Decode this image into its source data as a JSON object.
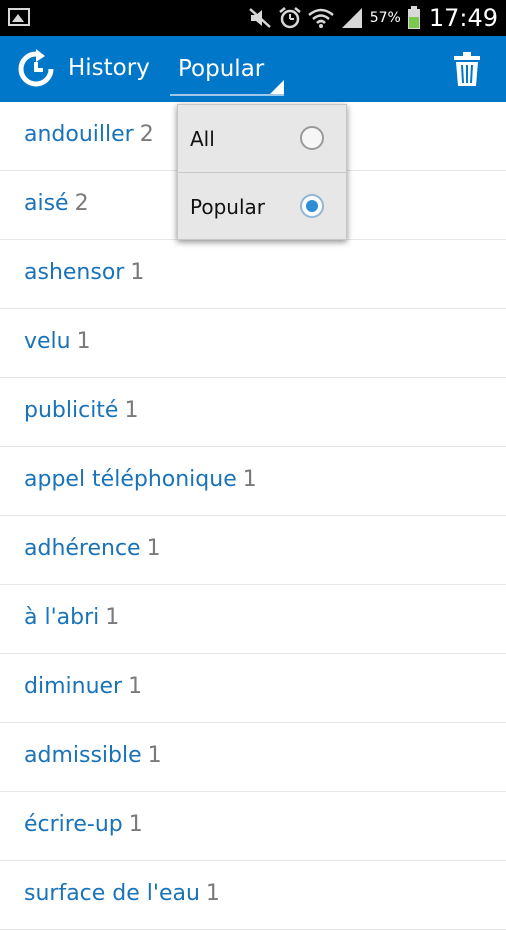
{
  "status_bar": {
    "battery_percent": "57%",
    "time": "17:49",
    "icons": [
      "image-notification-icon",
      "mute-icon",
      "alarm-icon",
      "wifi-icon",
      "signal-icon",
      "battery-icon"
    ]
  },
  "action_bar": {
    "title": "History",
    "spinner_value": "Popular",
    "icons": [
      "history-logo-icon",
      "trash-icon"
    ],
    "color": "#0077c8"
  },
  "dropdown": {
    "options": [
      {
        "label": "All",
        "checked": false
      },
      {
        "label": "Popular",
        "checked": true
      }
    ]
  },
  "history": {
    "items": [
      {
        "word": "andouiller",
        "count": "2"
      },
      {
        "word": "aisé",
        "count": "2"
      },
      {
        "word": "ashensor",
        "count": "1"
      },
      {
        "word": "velu",
        "count": "1"
      },
      {
        "word": "publicité",
        "count": "1"
      },
      {
        "word": "appel téléphonique",
        "count": "1"
      },
      {
        "word": "adhérence",
        "count": "1"
      },
      {
        "word": "à l'abri",
        "count": "1"
      },
      {
        "word": "diminuer",
        "count": "1"
      },
      {
        "word": "admissible",
        "count": "1"
      },
      {
        "word": "écrire-up",
        "count": "1"
      },
      {
        "word": "surface de l'eau",
        "count": "1"
      }
    ]
  }
}
